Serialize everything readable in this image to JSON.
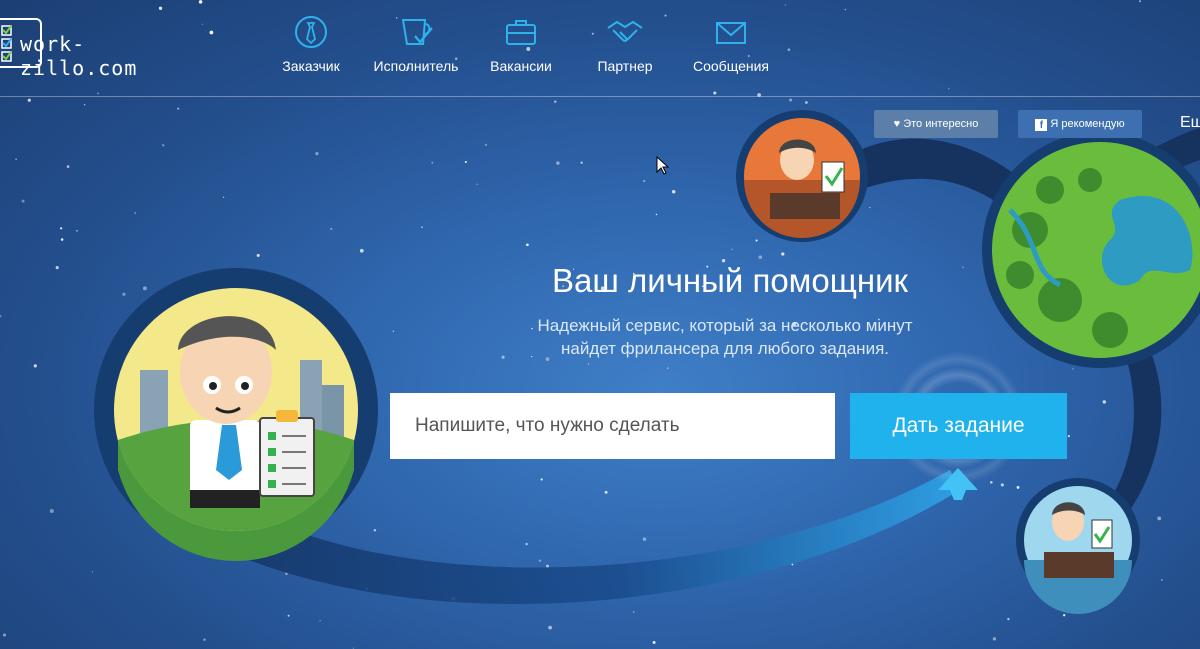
{
  "logo": {
    "text": "work-zillo.com"
  },
  "nav": [
    {
      "label": "Заказчик",
      "icon": "tie-icon"
    },
    {
      "label": "Исполнитель",
      "icon": "cup-check-icon"
    },
    {
      "label": "Вакансии",
      "icon": "briefcase-icon"
    },
    {
      "label": "Партнер",
      "icon": "handshake-icon"
    },
    {
      "label": "Сообщения",
      "icon": "envelope-icon"
    }
  ],
  "social": {
    "like_label": "Это интересно",
    "fb_label": "Я рекомендую",
    "more_label": "Еш"
  },
  "hero": {
    "title": "Ваш личный помощник",
    "subtitle_line1": "Надежный сервис, который за несколько минут",
    "subtitle_line2": "найдет фрилансера для любого задания."
  },
  "search": {
    "placeholder": "Напишите, что нужно сделать",
    "value": ""
  },
  "cta": {
    "label": "Дать задание"
  },
  "colors": {
    "accent": "#1fb2ec",
    "background": "#2f66ad",
    "like_button": "#5b7fa8",
    "fb_button": "#3e6fb0"
  }
}
